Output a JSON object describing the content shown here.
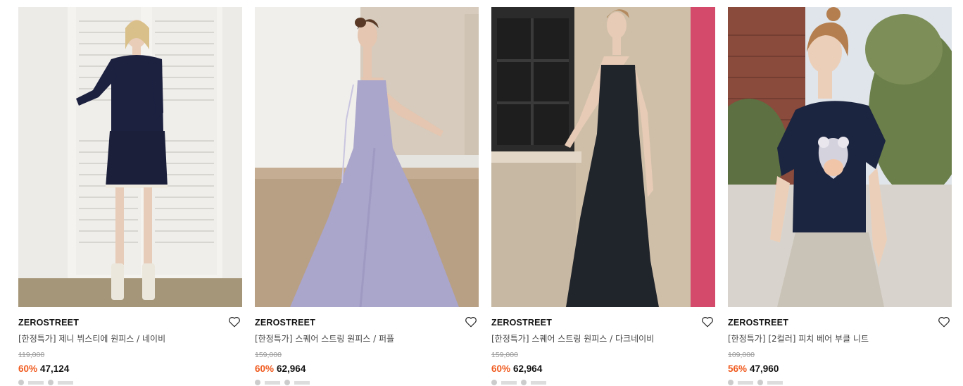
{
  "products": [
    {
      "brand": "ZEROSTREET",
      "title": "[한정특가] 제니 뷔스티에 원피스 / 네이비",
      "original_price": "119,000",
      "discount": "60%",
      "price": "47,124",
      "image_icon": "model-navy-tweed-dress-photo",
      "colors": {
        "bg": "#e9e8e6",
        "garment": "#1b1f3a",
        "floor": "#9e8f76",
        "shutter": "#f2f1ee"
      }
    },
    {
      "brand": "ZEROSTREET",
      "title": "[한정특가] 스퀘어 스트링 원피스 / 퍼플",
      "original_price": "159,000",
      "discount": "60%",
      "price": "62,964",
      "image_icon": "model-purple-slip-dress-photo",
      "colors": {
        "bg": "#d9d6cf",
        "garment": "#aba6cc",
        "floor": "#b39a7d",
        "wall": "#ece9e3"
      }
    },
    {
      "brand": "ZEROSTREET",
      "title": "[한정특가] 스퀘어 스트링 원피스 / 다크네이비",
      "original_price": "159,000",
      "discount": "60%",
      "price": "62,964",
      "image_icon": "model-darknavy-slip-dress-photo",
      "colors": {
        "bg": "#d2c5b3",
        "garment": "#1f2329",
        "accent": "#d5496a",
        "window": "#2a2a2a"
      }
    },
    {
      "brand": "ZEROSTREET",
      "title": "[한정특가] [2컬러] 피치 베어 부클 니트",
      "original_price": "109,000",
      "discount": "56%",
      "price": "47,960",
      "image_icon": "model-bear-knit-photo",
      "colors": {
        "bg": "#6f7f5a",
        "garment": "#1c2540",
        "pants": "#c9c2b7",
        "sky": "#dfe7ee"
      }
    }
  ],
  "wishlist_icon": "heart-outline-icon",
  "accent_color": "#f05a1e"
}
